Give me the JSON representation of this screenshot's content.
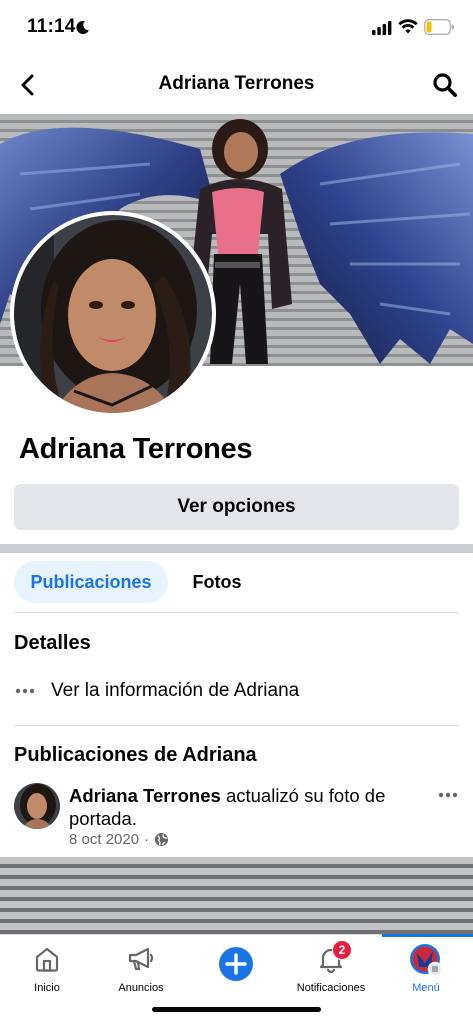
{
  "status": {
    "time": "11:14",
    "icons": [
      "moon-icon",
      "signal-icon",
      "wifi-icon",
      "battery-icon"
    ]
  },
  "header": {
    "title": "Adriana Terrones",
    "back_icon": "chevron-left-icon",
    "search_icon": "search-icon"
  },
  "profile": {
    "name": "Adriana Terrones",
    "options_label": "Ver opciones"
  },
  "tabs": [
    {
      "label": "Publicaciones",
      "active": true
    },
    {
      "label": "Fotos",
      "active": false
    }
  ],
  "details": {
    "heading": "Detalles",
    "info_link": "Ver la información de Adriana"
  },
  "posts": {
    "heading": "Publicaciones de Adriana",
    "items": [
      {
        "author": "Adriana Terrones",
        "action": " actualizó su foto de portada.",
        "date": "8 oct 2020",
        "separator": "·",
        "privacy_icon": "globe-icon"
      }
    ]
  },
  "bottom_nav": {
    "items": [
      {
        "label": "Inicio",
        "icon": "home-icon"
      },
      {
        "label": "Anuncios",
        "icon": "megaphone-icon"
      },
      {
        "label": "",
        "icon": "plus-circle-icon"
      },
      {
        "label": "Notificaciones",
        "icon": "bell-icon",
        "badge": "2"
      },
      {
        "label": "Menú",
        "icon": "avatar-menu-icon",
        "active": true
      }
    ]
  },
  "colors": {
    "accent": "#1b74e4",
    "badge": "#e41e3f",
    "button_bg": "#e4e6eb",
    "tab_active_bg": "#e7f3ff",
    "secondary_text": "#65676b"
  }
}
